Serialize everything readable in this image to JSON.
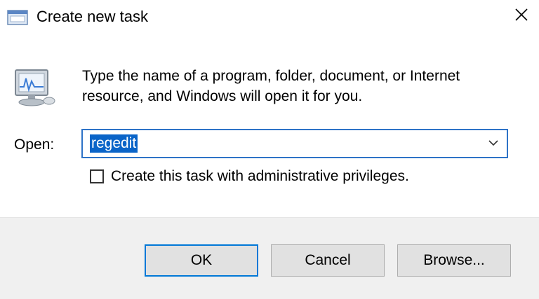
{
  "window": {
    "title": "Create new task",
    "title_icon": "run-dialog-icon",
    "close_icon": "close-icon"
  },
  "main": {
    "icon": "computer-monitor-icon",
    "description": "Type the name of a program, folder, document, or Internet resource, and Windows will open it for you.",
    "open_label": "Open:",
    "open_value": "regedit",
    "dropdown_icon": "chevron-down-icon",
    "admin_checkbox_label": "Create this task with administrative privileges.",
    "admin_checked": false
  },
  "buttons": {
    "ok": "OK",
    "cancel": "Cancel",
    "browse": "Browse..."
  },
  "colors": {
    "accent": "#0078d7",
    "selection": "#0a64c8",
    "footer_bg": "#f0f0f0",
    "button_bg": "#e1e1e1"
  }
}
